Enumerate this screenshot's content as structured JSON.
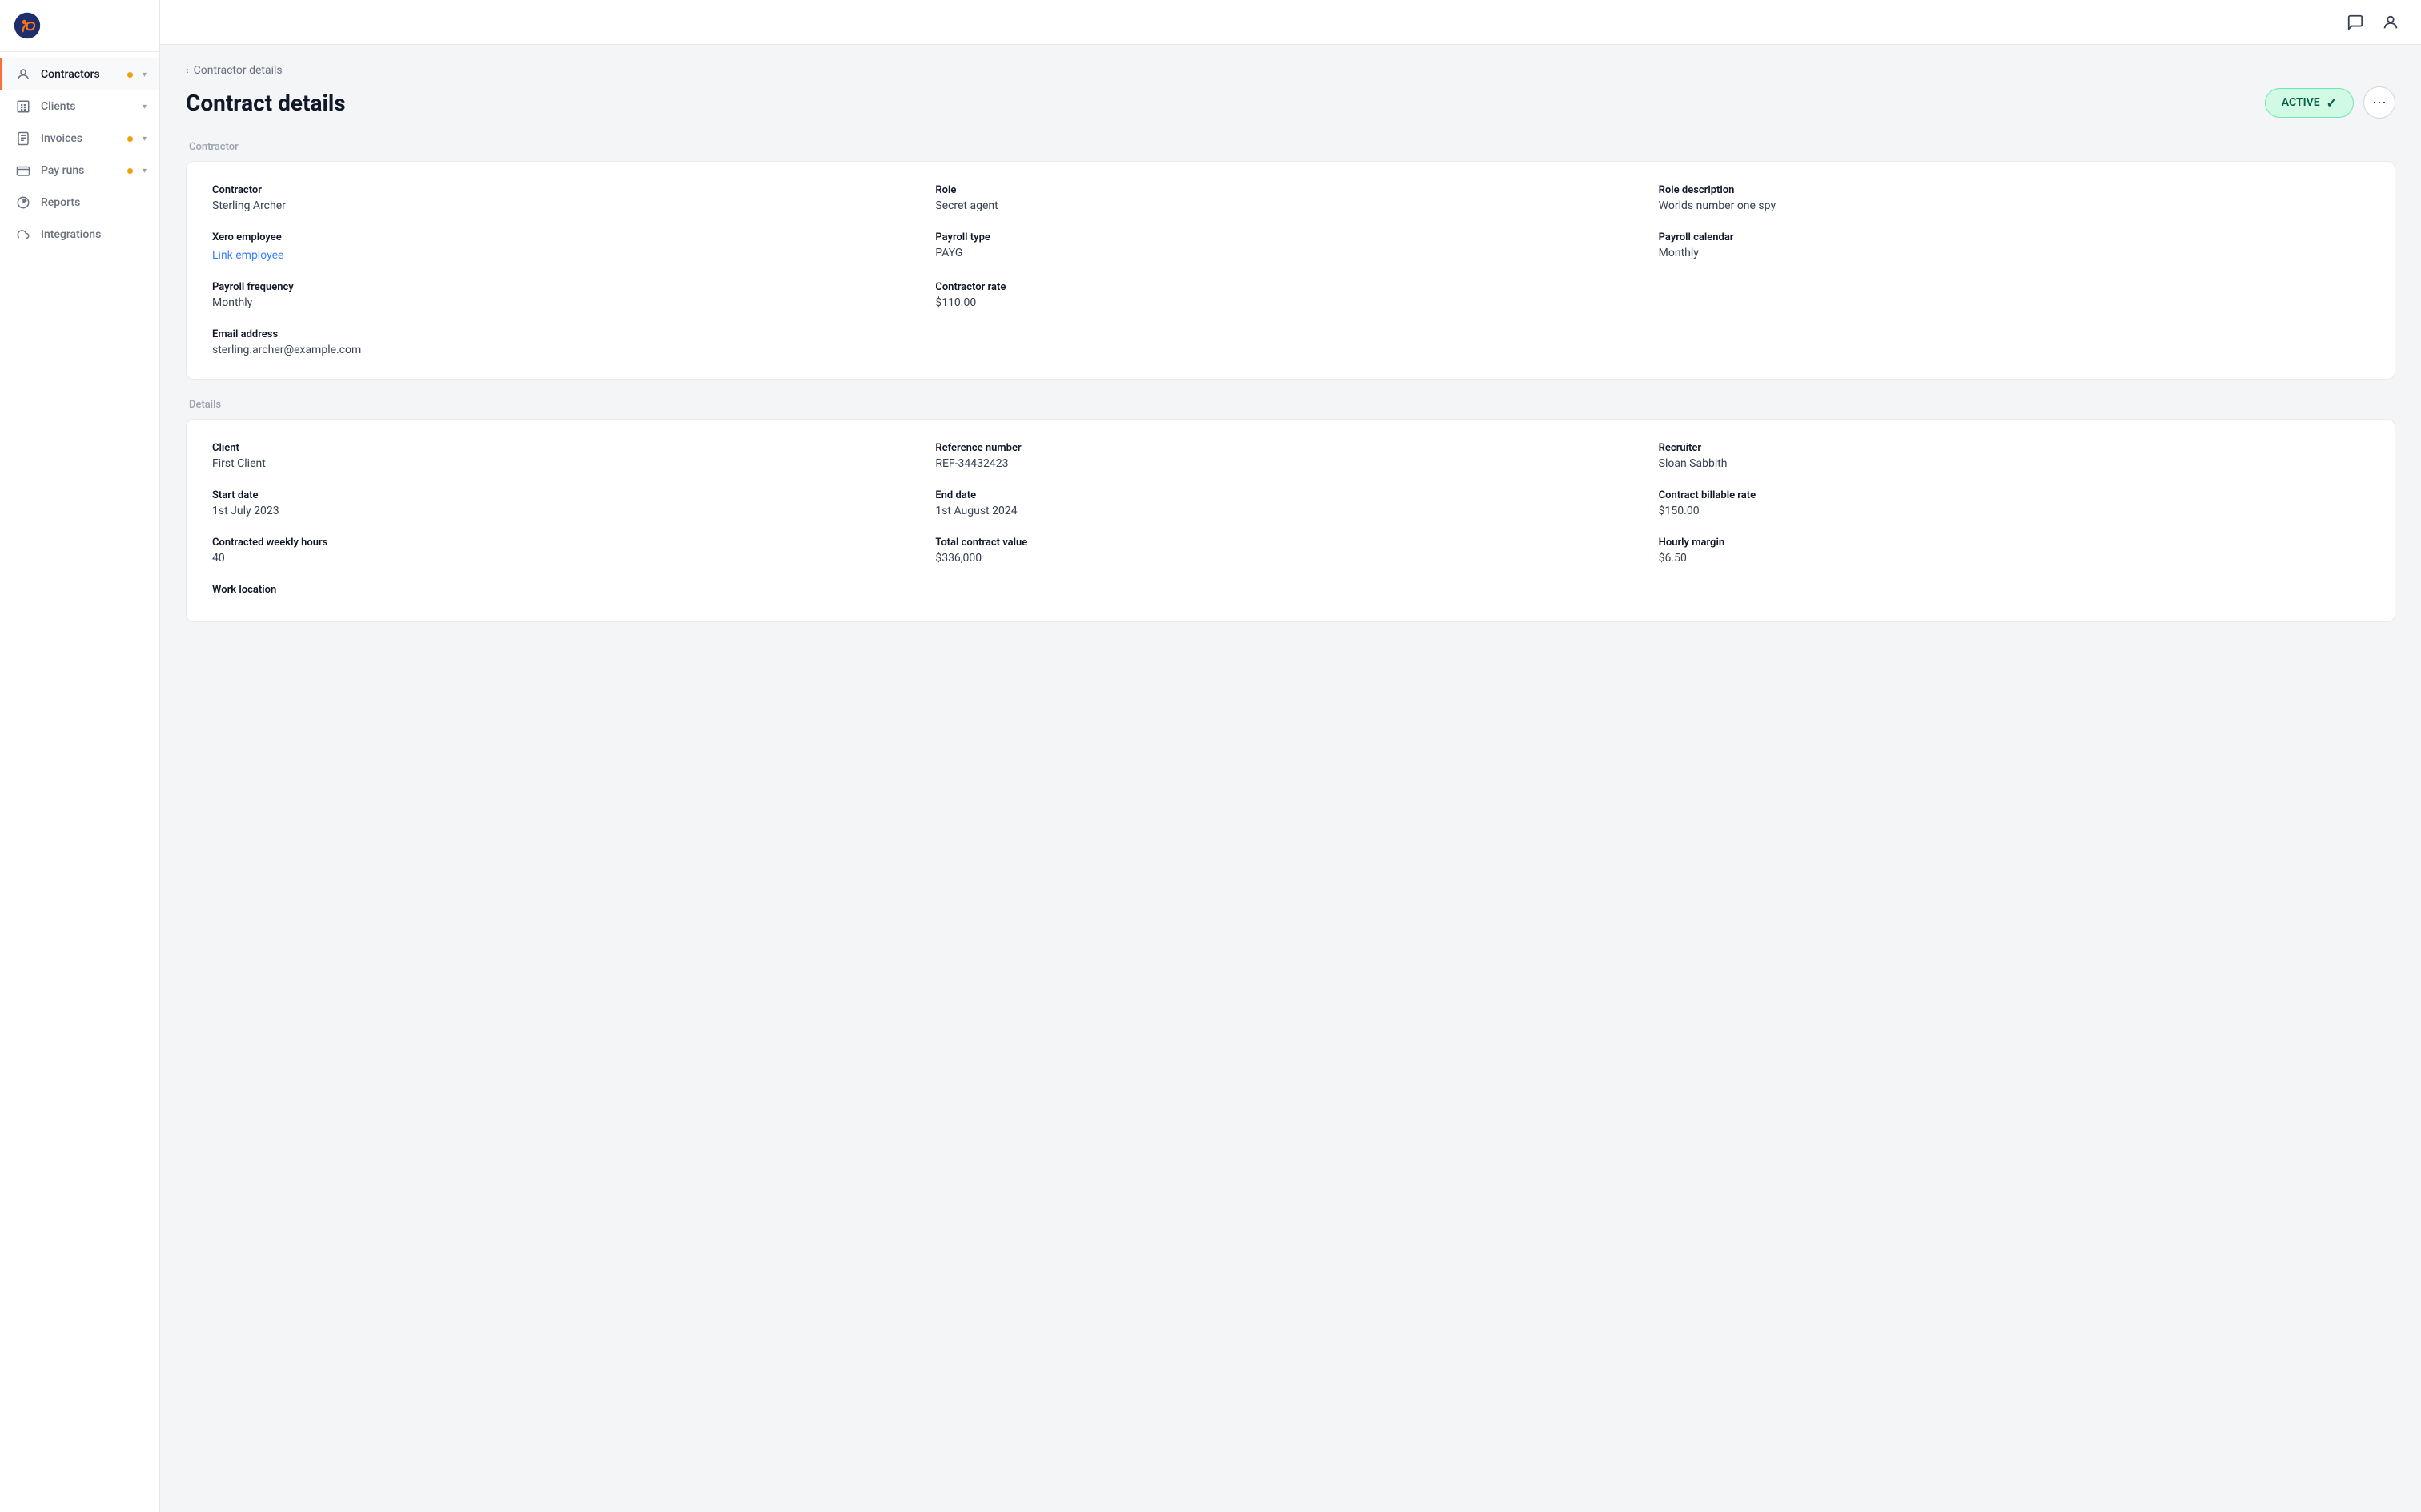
{
  "app": {
    "logo_alt": "Rippling logo"
  },
  "sidebar": {
    "items": [
      {
        "id": "contractors",
        "label": "Contractors",
        "active": true,
        "has_dot": true,
        "has_chevron": true,
        "icon": "person"
      },
      {
        "id": "clients",
        "label": "Clients",
        "active": false,
        "has_dot": false,
        "has_chevron": true,
        "icon": "building"
      },
      {
        "id": "invoices",
        "label": "Invoices",
        "active": false,
        "has_dot": true,
        "has_chevron": true,
        "icon": "invoice"
      },
      {
        "id": "pay-runs",
        "label": "Pay runs",
        "active": false,
        "has_dot": true,
        "has_chevron": true,
        "icon": "wallet"
      },
      {
        "id": "reports",
        "label": "Reports",
        "active": false,
        "has_dot": false,
        "has_chevron": false,
        "icon": "chart"
      },
      {
        "id": "integrations",
        "label": "Integrations",
        "active": false,
        "has_dot": false,
        "has_chevron": false,
        "icon": "cloud"
      }
    ]
  },
  "breadcrumb": {
    "label": "Contractor details"
  },
  "page": {
    "title": "Contract details",
    "status": "ACTIVE"
  },
  "contractor_section": {
    "label": "Contractor",
    "fields": [
      {
        "label": "Contractor",
        "value": "Sterling Archer",
        "is_link": false
      },
      {
        "label": "Role",
        "value": "Secret agent",
        "is_link": false
      },
      {
        "label": "Role description",
        "value": "Worlds number one spy",
        "is_link": false
      },
      {
        "label": "Xero employee",
        "value": "Link employee",
        "is_link": true
      },
      {
        "label": "Payroll type",
        "value": "PAYG",
        "is_link": false
      },
      {
        "label": "Payroll calendar",
        "value": "Monthly",
        "is_link": false
      },
      {
        "label": "Payroll frequency",
        "value": "Monthly",
        "is_link": false
      },
      {
        "label": "Contractor rate",
        "value": "$110.00",
        "is_link": false
      },
      {
        "label": "",
        "value": "",
        "is_link": false
      },
      {
        "label": "Email address",
        "value": "sterling.archer@example.com",
        "is_link": false
      }
    ]
  },
  "details_section": {
    "label": "Details",
    "fields": [
      {
        "label": "Client",
        "value": "First Client",
        "is_link": false
      },
      {
        "label": "Reference number",
        "value": "REF-34432423",
        "is_link": false
      },
      {
        "label": "Recruiter",
        "value": "Sloan Sabbith",
        "is_link": false
      },
      {
        "label": "Start date",
        "value": "1st July 2023",
        "is_link": false
      },
      {
        "label": "End date",
        "value": "1st August 2024",
        "is_link": false
      },
      {
        "label": "Contract billable rate",
        "value": "$150.00",
        "is_link": false
      },
      {
        "label": "Contracted weekly hours",
        "value": "40",
        "is_link": false
      },
      {
        "label": "Total contract value",
        "value": "$336,000",
        "is_link": false
      },
      {
        "label": "Hourly margin",
        "value": "$6.50",
        "is_link": false
      },
      {
        "label": "Work location",
        "value": "",
        "is_link": false
      }
    ]
  }
}
